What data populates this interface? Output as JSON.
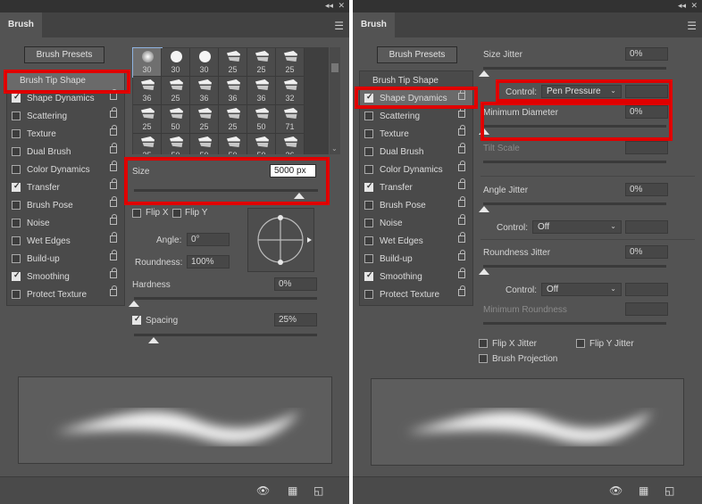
{
  "left": {
    "tab_label": "Brush",
    "brush_presets_label": "Brush Presets",
    "list_items": [
      {
        "label": "Brush Tip Shape",
        "checked": null,
        "lock": false,
        "selected": true
      },
      {
        "label": "Shape Dynamics",
        "checked": true,
        "lock": true
      },
      {
        "label": "Scattering",
        "checked": false,
        "lock": true
      },
      {
        "label": "Texture",
        "checked": false,
        "lock": true
      },
      {
        "label": "Dual Brush",
        "checked": false,
        "lock": true
      },
      {
        "label": "Color Dynamics",
        "checked": false,
        "lock": true
      },
      {
        "label": "Transfer",
        "checked": true,
        "lock": true
      },
      {
        "label": "Brush Pose",
        "checked": false,
        "lock": true
      },
      {
        "label": "Noise",
        "checked": false,
        "lock": true
      },
      {
        "label": "Wet Edges",
        "checked": false,
        "lock": true
      },
      {
        "label": "Build-up",
        "checked": false,
        "lock": true
      },
      {
        "label": "Smoothing",
        "checked": true,
        "lock": true
      },
      {
        "label": "Protect Texture",
        "checked": false,
        "lock": true
      }
    ],
    "brush_sizes": [
      "30",
      "30",
      "30",
      "25",
      "25",
      "25",
      "36",
      "25",
      "36",
      "36",
      "36",
      "32",
      "25",
      "50",
      "25",
      "25",
      "50",
      "71",
      "25",
      "50",
      "50",
      "50",
      "50",
      "36"
    ],
    "size_label": "Size",
    "size_value": "5000 px",
    "size_fraction": 0.9,
    "flip_x_label": "Flip X",
    "flip_y_label": "Flip Y",
    "angle_label": "Angle:",
    "angle_value": "0°",
    "roundness_label": "Roundness:",
    "roundness_value": "100%",
    "hardness_label": "Hardness",
    "hardness_value": "0%",
    "spacing_label": "Spacing",
    "spacing_value": "25%",
    "spacing_checked": true
  },
  "right": {
    "tab_label": "Brush",
    "brush_presets_label": "Brush Presets",
    "list_items": [
      {
        "label": "Brush Tip Shape",
        "checked": null,
        "lock": false
      },
      {
        "label": "Shape Dynamics",
        "checked": true,
        "lock": true,
        "selected": true
      },
      {
        "label": "Scattering",
        "checked": false,
        "lock": true
      },
      {
        "label": "Texture",
        "checked": false,
        "lock": true
      },
      {
        "label": "Dual Brush",
        "checked": false,
        "lock": true
      },
      {
        "label": "Color Dynamics",
        "checked": false,
        "lock": true
      },
      {
        "label": "Transfer",
        "checked": true,
        "lock": true
      },
      {
        "label": "Brush Pose",
        "checked": false,
        "lock": true
      },
      {
        "label": "Noise",
        "checked": false,
        "lock": true
      },
      {
        "label": "Wet Edges",
        "checked": false,
        "lock": true
      },
      {
        "label": "Build-up",
        "checked": false,
        "lock": true
      },
      {
        "label": "Smoothing",
        "checked": true,
        "lock": true
      },
      {
        "label": "Protect Texture",
        "checked": false,
        "lock": true
      }
    ],
    "size_jitter_label": "Size Jitter",
    "size_jitter_value": "0%",
    "control_label": "Control:",
    "control_value_pen": "Pen Pressure",
    "min_diameter_label": "Minimum Diameter",
    "min_diameter_value": "0%",
    "tilt_scale_label": "Tilt Scale",
    "angle_jitter_label": "Angle Jitter",
    "angle_jitter_value": "0%",
    "control_value_off": "Off",
    "roundness_jitter_label": "Roundness Jitter",
    "roundness_jitter_value": "0%",
    "min_roundness_label": "Minimum Roundness",
    "flip_x_jitter_label": "Flip X Jitter",
    "flip_y_jitter_label": "Flip Y Jitter",
    "brush_projection_label": "Brush Projection"
  },
  "colors": {
    "highlight_red": "#e00000",
    "panel_bg": "#535353"
  }
}
